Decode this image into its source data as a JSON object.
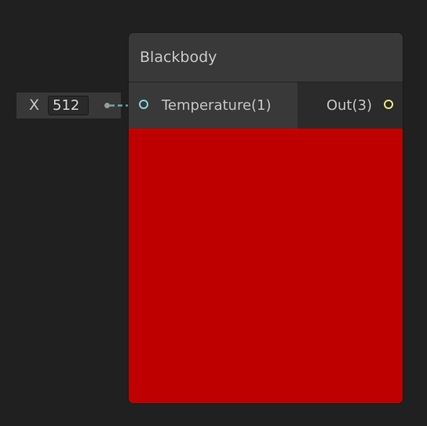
{
  "inline_field": {
    "axis_label": "X",
    "value": "512"
  },
  "node": {
    "title": "Blackbody",
    "input_port": {
      "label": "Temperature(1)",
      "color": "#84d4dc"
    },
    "output_port": {
      "label": "Out(3)",
      "color": "#e6e67a"
    },
    "preview": {
      "color": "#bf0000"
    }
  }
}
